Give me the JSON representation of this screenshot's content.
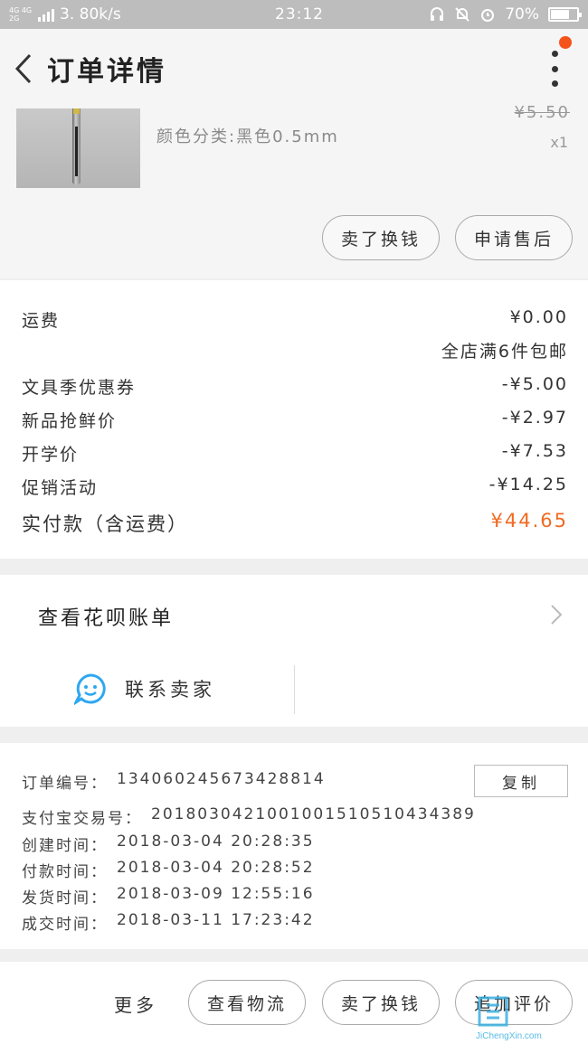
{
  "status_bar": {
    "network": "4G 4G 2G",
    "speed": "3. 80k/s",
    "time": "23:12",
    "battery": "70%",
    "battery_level": 0.7
  },
  "header": {
    "title": "订单详情"
  },
  "product": {
    "variant": "颜色分类:黑色0.5mm",
    "original_price": "¥5.50",
    "quantity": "x1",
    "buttons": {
      "exchange": "卖了换钱",
      "after_sale": "申请售后"
    }
  },
  "prices": {
    "shipping_label": "运费",
    "shipping_value": "¥0.00",
    "free_shipping_note": "全店满6件包邮",
    "coupon_label": "文具季优惠券",
    "coupon_value": "-¥5.00",
    "new_product_label": "新品抢鲜价",
    "new_product_value": "-¥2.97",
    "school_label": "开学价",
    "school_value": "-¥7.53",
    "promo_label": "促销活动",
    "promo_value": "-¥14.25",
    "total_label": "实付款（含运费）",
    "total_value": "¥44.65"
  },
  "huabei": {
    "label": "查看花呗账单",
    "contact_label": "联系卖家"
  },
  "order_info": {
    "copy_label": "复制",
    "rows": [
      {
        "label": "订单编号：",
        "value": "134060245673428814"
      },
      {
        "label": "支付宝交易号：",
        "value": "2018030421001001510510434389"
      },
      {
        "label": "创建时间：",
        "value": "2018-03-04 20:28:35"
      },
      {
        "label": "付款时间：",
        "value": "2018-03-04 20:28:52"
      },
      {
        "label": "发货时间：",
        "value": "2018-03-09 12:55:16"
      },
      {
        "label": "成交时间：",
        "value": "2018-03-11 17:23:42"
      }
    ]
  },
  "bottom_bar": {
    "more_label": "更多",
    "logistics_label": "查看物流",
    "exchange_label": "卖了换钱",
    "review_label": "追加评价"
  },
  "watermark": {
    "text": "JiChengXin.com"
  },
  "colors": {
    "accent_orange": "#f06a22",
    "notification_dot": "#f5531c",
    "contact_icon": "#2ea7f0"
  }
}
